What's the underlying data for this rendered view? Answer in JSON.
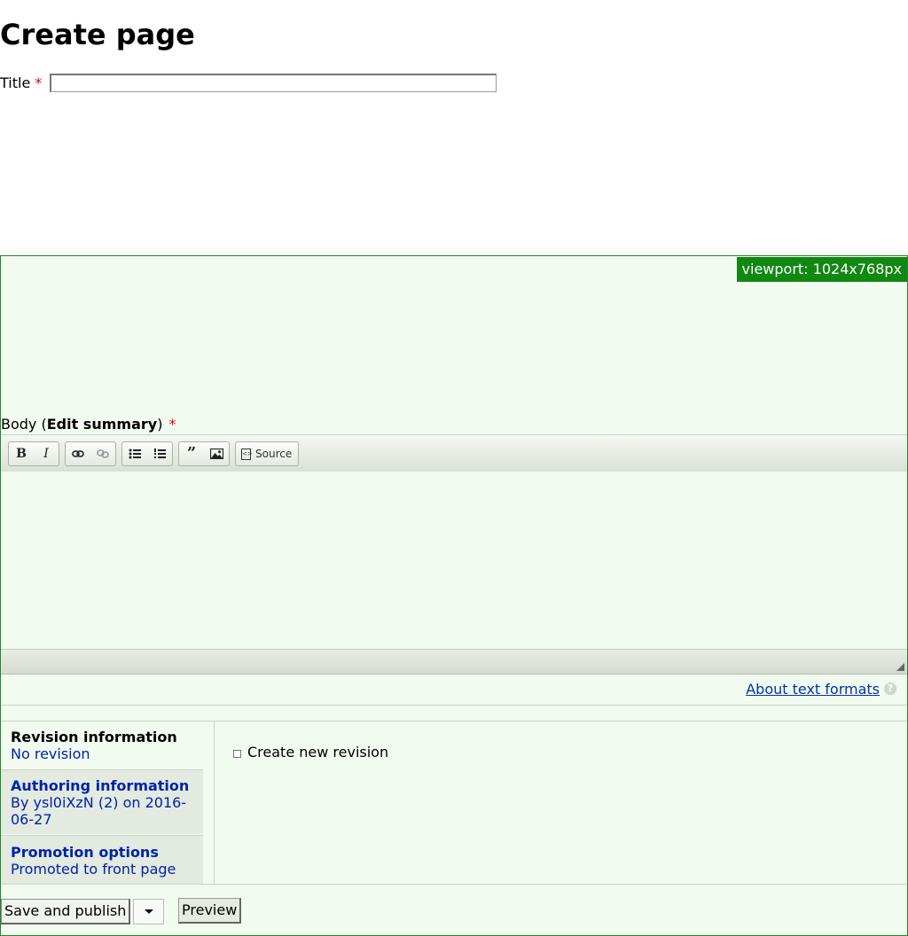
{
  "page": {
    "heading": "Create page"
  },
  "title_field": {
    "label": "Title",
    "required_marker": "*",
    "value": "",
    "placeholder": ""
  },
  "viewport_badge": "viewport: 1024x768px",
  "body_field": {
    "label_prefix": "Body (",
    "summary_link": "Edit summary",
    "label_suffix": ")",
    "required_marker": "*"
  },
  "toolbar": {
    "bold": "B",
    "italic": "I",
    "source_label": "Source",
    "icons": [
      "bold-icon",
      "italic-icon",
      "link-icon",
      "unlink-icon",
      "bulleted-list-icon",
      "numbered-list-icon",
      "blockquote-icon",
      "image-icon",
      "source-icon"
    ]
  },
  "text_formats": {
    "about_link": "About text formats",
    "help_symbol": "?"
  },
  "vertical_tabs": [
    {
      "title": "Revision information",
      "summary": "No revision"
    },
    {
      "title": "Authoring information",
      "summary": "By ysl0iXzN (2) on 2016-06-27"
    },
    {
      "title": "Promotion options",
      "summary": "Promoted to front page"
    }
  ],
  "revision_pane": {
    "checkbox_label": "Create new revision",
    "checked": false
  },
  "actions": {
    "save_label": "Save and publish",
    "preview_label": "Preview"
  }
}
